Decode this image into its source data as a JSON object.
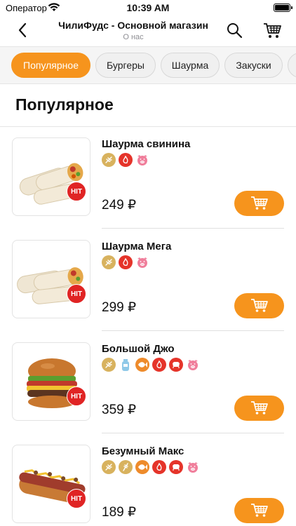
{
  "status_bar": {
    "carrier": "Оператор",
    "time": "10:39 AM"
  },
  "header": {
    "title": "ЧилиФудс - Основной магазин",
    "subtitle": "О нас"
  },
  "tabs": [
    {
      "label": "Популярное",
      "active": true
    },
    {
      "label": "Бургеры",
      "active": false
    },
    {
      "label": "Шаурма",
      "active": false
    },
    {
      "label": "Закуски",
      "active": false
    }
  ],
  "section": {
    "title": "Популярное"
  },
  "badge_label": "HIT",
  "products": [
    {
      "name": "Шаурма свинина",
      "price": "249 ₽",
      "icons": [
        "wheat-icon",
        "chili-icon",
        "pig-icon"
      ]
    },
    {
      "name": "Шаурма Мега",
      "price": "299 ₽",
      "icons": [
        "wheat-icon",
        "chili-icon",
        "pig-icon"
      ]
    },
    {
      "name": "Большой Джо",
      "price": "359 ₽",
      "icons": [
        "wheat-icon",
        "bottle-icon",
        "fish-icon",
        "chili-icon",
        "cow-icon",
        "pig-icon"
      ]
    },
    {
      "name": "Безумный Макс",
      "price": "189 ₽",
      "icons": [
        "wheat-icon",
        "wheat-icon",
        "fish-icon",
        "chili-icon",
        "cow-icon",
        "pig-icon"
      ]
    }
  ],
  "colors": {
    "accent": "#f6941d",
    "badge": "#e02424",
    "icon_gold": "#d8b25e",
    "icon_red": "#e5342a",
    "icon_orange": "#ee8b2b",
    "icon_pink": "#f07e9b"
  }
}
